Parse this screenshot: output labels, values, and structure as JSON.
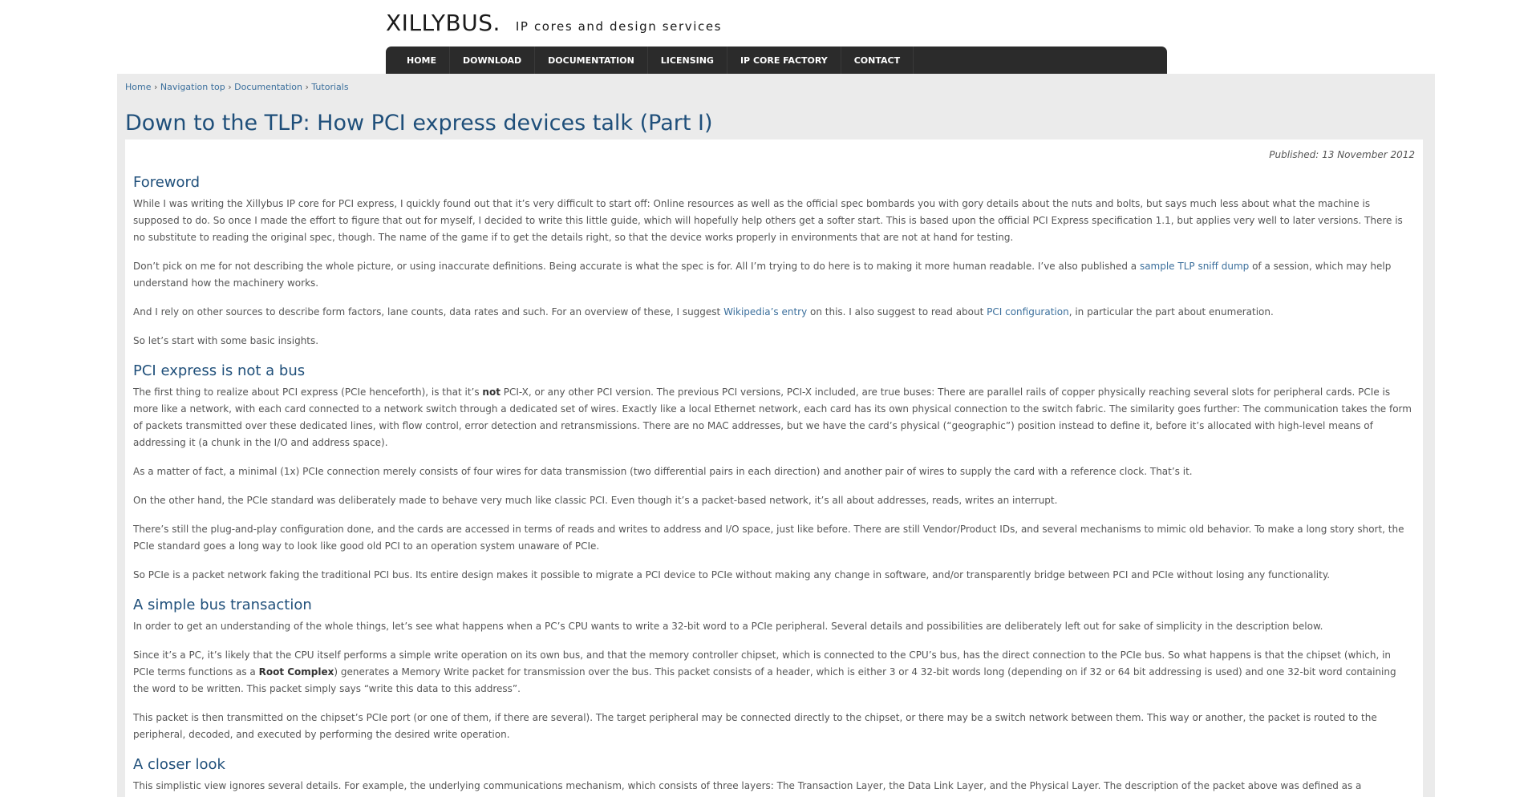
{
  "site": {
    "name": "XILLYBUS.",
    "tagline": "IP cores and design services"
  },
  "nav": {
    "items": [
      "HOME",
      "DOWNLOAD",
      "DOCUMENTATION",
      "LICENSING",
      "IP CORE FACTORY",
      "CONTACT"
    ]
  },
  "breadcrumb": {
    "items": [
      "Home",
      "Navigation top",
      "Documentation",
      "Tutorials"
    ],
    "separator": "›"
  },
  "page": {
    "title": "Down to the TLP: How PCI express devices talk (Part I)",
    "published": "Published: 13 November 2012"
  },
  "article": {
    "s1": {
      "heading": "Foreword",
      "p1": "While I was writing the Xillybus IP core for PCI express, I quickly found out that it’s very difficult to start off: Online resources as well as the official spec bombards you with gory details about the nuts and bolts, but says much less about what the machine is supposed to do. So once I made the effort to figure that out for myself, I decided to write this little guide, which will hopefully help others get a softer start. This is based upon the official PCI Express specification 1.1, but applies very well to later versions. There is no substitute to reading the original spec, though. The name of the game if to get the details right, so that the device works properly in environments that are not at hand for testing.",
      "p2_before": "Don’t pick on me for not describing the whole picture, or using inaccurate definitions. Being accurate is what the spec is for. All I’m trying to do here is to making it more human readable. I’ve also published a ",
      "p2_link": "sample TLP sniff dump",
      "p2_after": " of a session, which may help understand how the machinery works.",
      "p3_before": "And I rely on other sources to describe form factors, lane counts, data rates and such. For an overview of these, I suggest ",
      "p3_link1": "Wikipedia’s entry",
      "p3_mid": " on this. I also suggest to read about ",
      "p3_link2": "PCI configuration",
      "p3_after": ", in particular the part about enumeration.",
      "p4": "So let’s start with some basic insights."
    },
    "s2": {
      "heading": "PCI express is not a bus",
      "p1_before": "The first thing to realize about PCI express (PCIe henceforth), is that it’s ",
      "p1_bold": "not",
      "p1_after": " PCI-X, or any other PCI version. The previous PCI versions, PCI-X included, are true buses: There are parallel rails of copper physically reaching several slots for peripheral cards. PCIe is more like a network, with each card connected to a network switch through a dedicated set of wires. Exactly like a local Ethernet network, each card has its own physical connection to the switch fabric. The similarity goes further: The communication takes the form of packets transmitted over these dedicated lines, with flow control, error detection and retransmissions. There are no MAC addresses, but we have the card’s physical (“geographic”) position instead to define it, before it’s allocated with high-level means of addressing it (a chunk in the I/O and address space).",
      "p2": "As a matter of fact, a minimal (1x) PCIe connection merely consists of four wires for data transmission (two differential pairs in each direction) and another pair of wires to supply the card with a reference clock. That’s it.",
      "p3": "On the other hand, the PCIe standard was deliberately made to behave very much like classic PCI. Even though it’s a packet-based network, it’s all about addresses, reads, writes an interrupt.",
      "p4": "There’s still the plug-and-play configuration done, and the cards are accessed in terms of reads and writes to address and I/O space, just like before. There are still Vendor/Product IDs, and several mechanisms to mimic old behavior. To make a long story short, the PCIe standard goes a long way to look like good old PCI to an operation system unaware of PCIe.",
      "p5": "So PCIe is a packet network faking the traditional PCI bus. Its entire design makes it possible to migrate a PCI device to PCIe without making any change in software, and/or transparently bridge between PCI and PCIe without losing any functionality."
    },
    "s3": {
      "heading": "A simple bus transaction",
      "p1": "In order to get an understanding of the whole things, let’s see what happens when a PC’s CPU wants to write a 32-bit word to a PCIe peripheral. Several details and possibilities are deliberately left out for sake of simplicity in the description below.",
      "p2_before": "Since it’s a PC, it’s likely that the CPU itself performs a simple write operation on its own bus, and that the memory controller chipset, which is connected to the CPU’s bus, has the direct connection to the PCIe bus. So what happens is that the chipset (which, in PCIe terms functions as a ",
      "p2_bold": "Root Complex",
      "p2_after": ") generates a Memory Write packet for transmission over the bus. This packet consists of a header, which is either 3 or 4 32-bit words long (depending on if 32 or 64 bit addressing is used) and one 32-bit word containing the word to be written. This packet simply says “write this data to this address”.",
      "p3": "This packet is then transmitted on the chipset’s PCIe port (or one of them, if there are several). The target peripheral may be connected directly to the chipset, or there may be a switch network between them. This way or another, the packet is routed to the peripheral, decoded, and executed by performing the desired write operation."
    },
    "s4": {
      "heading": "A closer look",
      "p1": "This simplistic view ignores several details. For example, the underlying communications mechanism, which consists of three layers: The Transaction Layer, the Data Link Layer, and the Physical Layer. The description of the packet above was defined as a Transaction Layer Packet (TLP), which relates to PCIe’s uppermost layer."
    }
  }
}
